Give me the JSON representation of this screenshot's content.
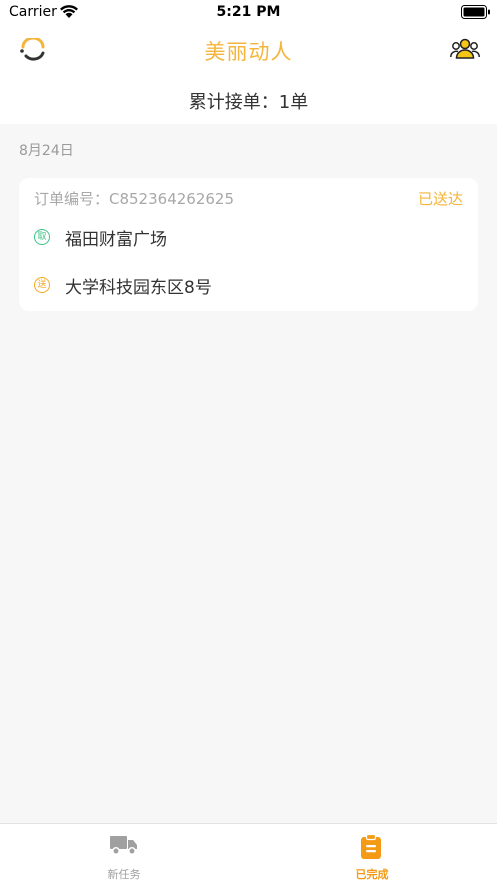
{
  "status_bar": {
    "carrier": "Carrier",
    "time": "5:21 PM"
  },
  "nav": {
    "title": "美丽动人",
    "left_icon": "loading-face-icon",
    "right_icon": "users-group-icon"
  },
  "summary": {
    "text": "累计接单：1单"
  },
  "orders_section": {
    "date": "8月24日",
    "orders": [
      {
        "order_number_label": "订单编号：C852364262625",
        "status": "已送达",
        "pickup_badge": "取",
        "pickup_address": "福田财富广场",
        "delivery_badge": "送",
        "delivery_address": "大学科技园东区8号"
      }
    ]
  },
  "tab_bar": {
    "tabs": [
      {
        "label": "新任务",
        "icon": "truck-icon",
        "active": false
      },
      {
        "label": "已完成",
        "icon": "clipboard-icon",
        "active": true
      }
    ]
  },
  "colors": {
    "accent": "#f5b53d",
    "active_tab": "#f59a14",
    "inactive_tab": "#a0a0a0",
    "pickup_green": "#3fc284",
    "delivery_orange": "#f5a623",
    "background": "#f7f7f7"
  }
}
